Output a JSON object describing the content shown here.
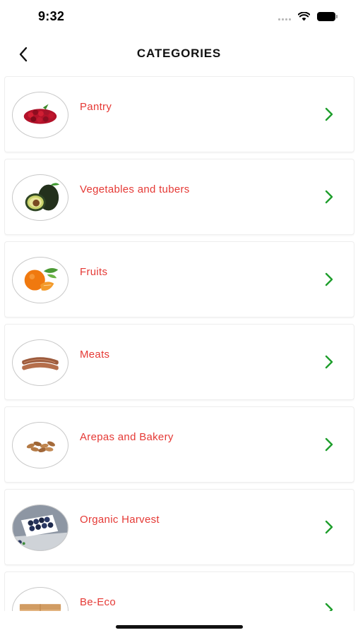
{
  "status_bar": {
    "time": "9:32"
  },
  "header": {
    "title": "CATEGORIES"
  },
  "categories": [
    {
      "label": "Pantry",
      "icon": "dried-berries-icon"
    },
    {
      "label": "Vegetables and tubers",
      "icon": "avocado-icon"
    },
    {
      "label": "Fruits",
      "icon": "tangerine-icon"
    },
    {
      "label": "Meats",
      "icon": "sausage-icon"
    },
    {
      "label": "Arepas and Bakery",
      "icon": "almonds-icon"
    },
    {
      "label": "Organic Harvest",
      "icon": "blueberries-icon"
    },
    {
      "label": "Be-Eco",
      "icon": "wooden-box-icon"
    }
  ],
  "colors": {
    "label": "#e53935",
    "chevron": "#1e9e2c",
    "card_border": "#eeeeee"
  }
}
